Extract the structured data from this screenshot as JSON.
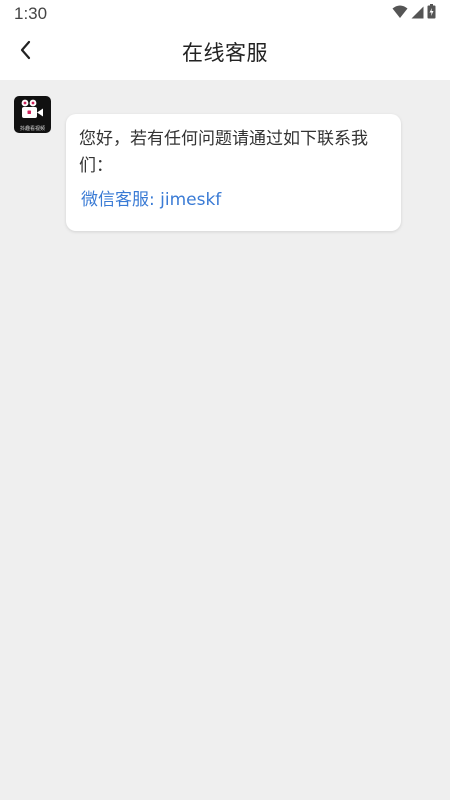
{
  "status_bar": {
    "time": "1:30",
    "icons": [
      "wifi-icon",
      "signal-icon",
      "battery-icon"
    ]
  },
  "header": {
    "title": "在线客服",
    "back_icon": "chevron-left-icon"
  },
  "chat": {
    "avatar_caption": "抖趣看视频",
    "message": "您好，若有任何问题请通过如下联系我们：",
    "contact": "微信客服: jimeskf"
  },
  "colors": {
    "background": "#efefef",
    "link": "#3a7bd5",
    "title": "#222222"
  }
}
